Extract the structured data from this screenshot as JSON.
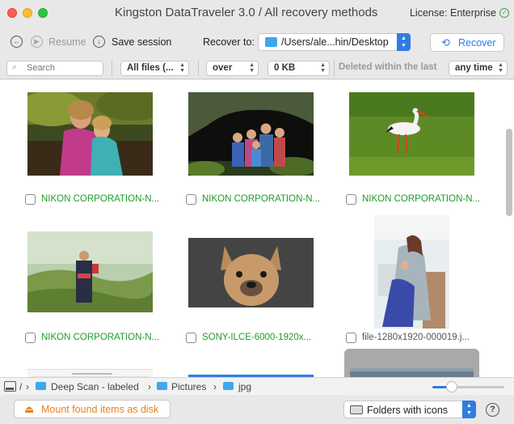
{
  "window": {
    "title": "Kingston DataTraveler 3.0 / All recovery methods",
    "license": "License: Enterprise"
  },
  "toolbar": {
    "resume_label": "Resume",
    "save_session_label": "Save session",
    "recover_to_label": "Recover to:",
    "recover_path": "/Users/ale...hin/Desktop",
    "recover_label": "Recover"
  },
  "filters": {
    "search_placeholder": "Search",
    "file_type": "All files (...",
    "size_operator": "over",
    "size_value": "0 KB",
    "deleted_label": "Deleted within the last",
    "deleted_period": "any time"
  },
  "files": [
    {
      "name": "NIKON CORPORATION-N...",
      "status": "green",
      "icon": "girls-on-tree-photo"
    },
    {
      "name": "NIKON CORPORATION-N...",
      "status": "green",
      "icon": "family-in-cave-photo"
    },
    {
      "name": "NIKON CORPORATION-N...",
      "status": "green",
      "icon": "stork-on-grass-photo"
    },
    {
      "name": "NIKON CORPORATION-N...",
      "status": "green",
      "icon": "woman-carrying-child-photo"
    },
    {
      "name": "SONY-ILCE-6000-1920x...",
      "status": "green",
      "icon": "french-bulldog-photo"
    },
    {
      "name": "file-1280x1920-000019.j...",
      "status": "gray",
      "icon": "mother-and-child-photo"
    }
  ],
  "breadcrumb": {
    "root": "/",
    "items": [
      "Deep Scan - labeled",
      "Pictures",
      "jpg"
    ]
  },
  "bottom": {
    "mount_label": "Mount found items as disk",
    "view_mode": "Folders with icons",
    "help_label": "?"
  },
  "colors": {
    "accent": "#2f7de1",
    "found_green": "#1f9c29",
    "mount_orange": "#e8801f"
  }
}
